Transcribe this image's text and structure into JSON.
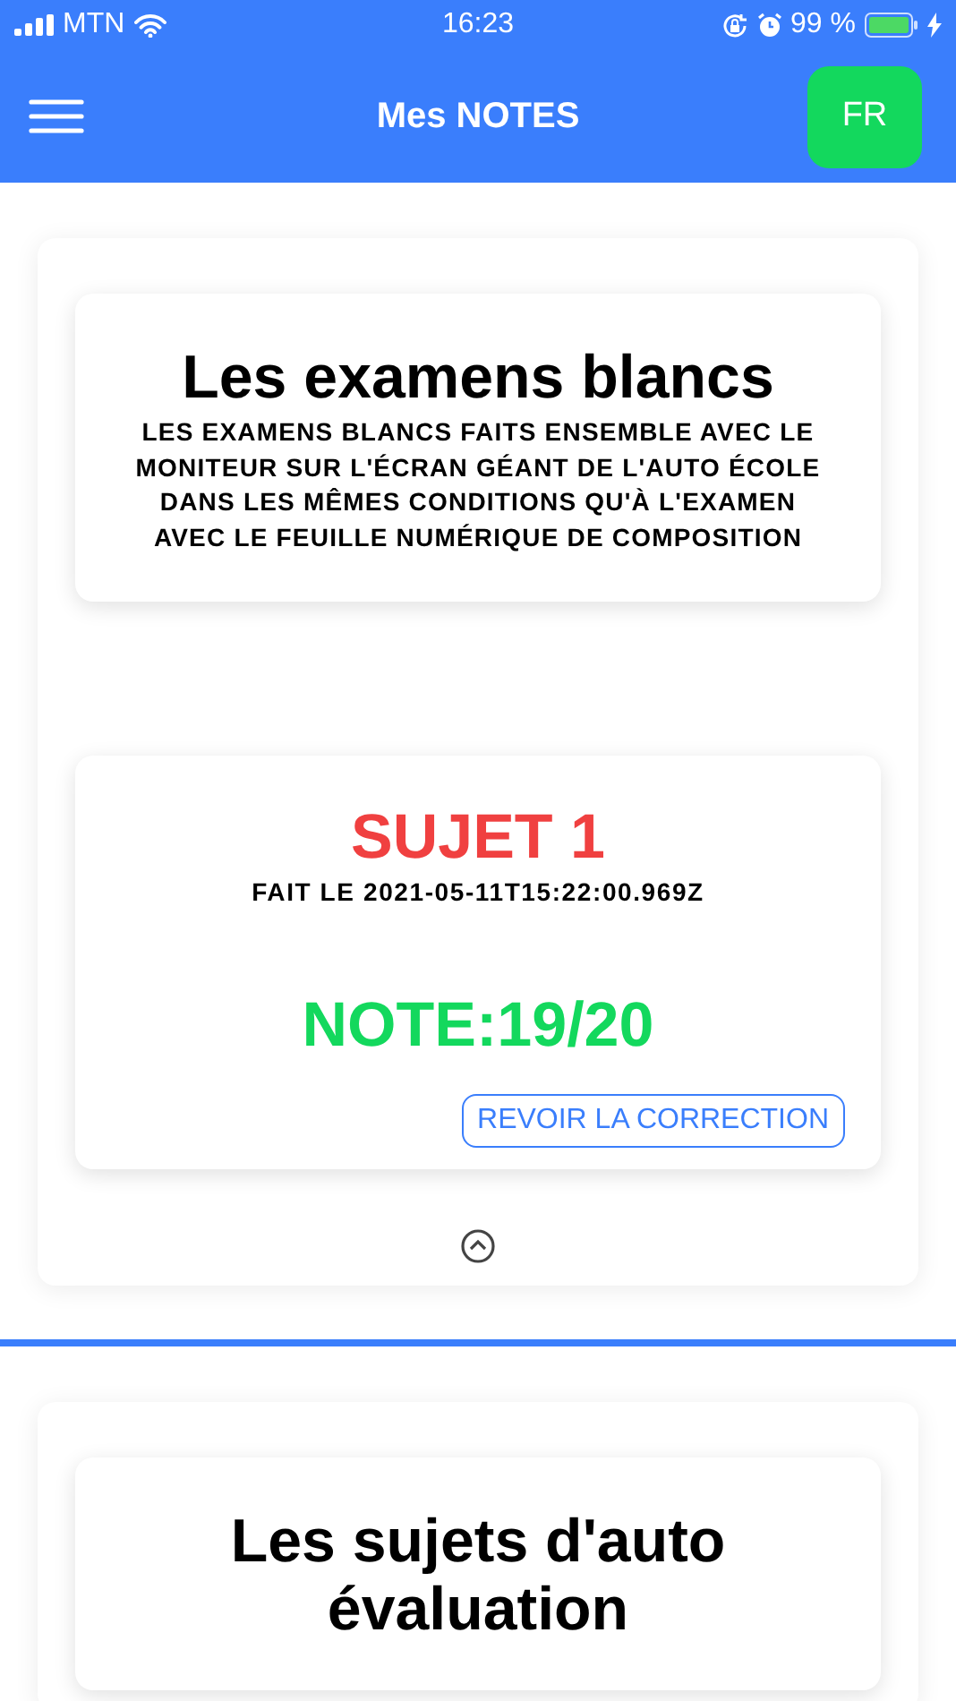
{
  "status_bar": {
    "carrier": "MTN",
    "time": "16:23",
    "battery": "99 %"
  },
  "header": {
    "title": "Mes NOTES",
    "language_button": "FR"
  },
  "sections": [
    {
      "title": "Les examens blancs",
      "description": "LES EXAMENS BLANCS FAITS ENSEMBLE AVEC LE MONITEUR SUR L'ÉCRAN GÉANT DE L'AUTO ÉCOLE DANS LES MÊMES CONDITIONS QU'À L'EXAMEN AVEC LE FEUILLE NUMÉRIQUE DE COMPOSITION",
      "results": [
        {
          "subject": "SUJET 1",
          "date": "FAIT LE 2021-05-11T15:22:00.969Z",
          "score": "NOTE:19/20",
          "action": "REVOIR LA CORRECTION"
        }
      ],
      "expanded": true
    },
    {
      "title": "Les sujets d'auto évaluation"
    }
  ]
}
